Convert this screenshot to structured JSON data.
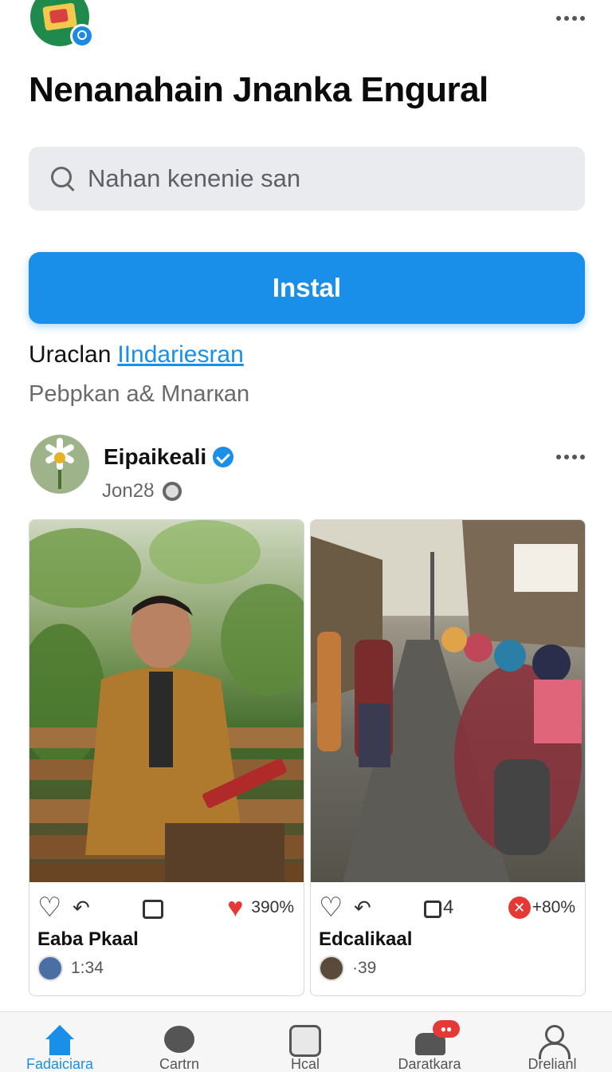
{
  "header": {
    "title": "Nenanahain Jnanka Engural"
  },
  "search": {
    "placeholder": "Nahan kenenie san"
  },
  "install_button": {
    "label": "Instal"
  },
  "developer": {
    "prefix": "Uraclan",
    "link": "IIndariesran"
  },
  "subtitle": "Pebpkan a& Mnarкan",
  "post": {
    "author": "Eipaikeali",
    "date": "Jon2ȣ",
    "cards": [
      {
        "reaction_count": "390%",
        "title": "Eaba Pkaal",
        "time": "1:34",
        "reaction_icon": "heart-icon"
      },
      {
        "reaction_count": "+80%",
        "comment_count": "4",
        "title": "Edcalikaal",
        "time": "·39",
        "reaction_icon": "cross-icon"
      }
    ]
  },
  "nav": {
    "items": [
      {
        "label": "Fadaiciara",
        "icon": "home-icon"
      },
      {
        "label": "Cartrn",
        "icon": "chat-icon"
      },
      {
        "label": "Hcal",
        "icon": "square-icon"
      },
      {
        "label": "Daratkara",
        "icon": "notification-icon"
      },
      {
        "label": "Drelianl",
        "icon": "profile-icon"
      }
    ]
  },
  "colors": {
    "accent": "#1a8fea",
    "alert": "#e53935"
  }
}
